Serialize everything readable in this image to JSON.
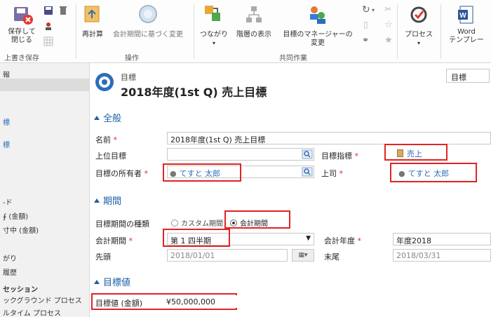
{
  "ribbon": {
    "save_close": "保存して\n閉じる",
    "save_group": "上書き保存",
    "recalc": "再計算",
    "fiscal_change": "会計期間に基づく変更",
    "ops_group": "操作",
    "connection": "つながり",
    "hierarchy": "階層の表示",
    "manager_change": "目標のマネージャーの\n変更",
    "collab_group": "共同作業",
    "process": "プロセス",
    "word_template": "Word\nテンプレー"
  },
  "leftnav": {
    "items": [
      {
        "label": "報",
        "blue": false
      },
      {
        "label": "標",
        "blue": true
      },
      {
        "label": "標",
        "blue": true
      },
      {
        "label": "-ド",
        "blue": false
      },
      {
        "label": "∮ (金額)",
        "blue": false
      },
      {
        "label": "寸中 (金額)",
        "blue": false
      },
      {
        "label": "がり",
        "blue": false
      },
      {
        "label": "履歴",
        "blue": false
      },
      {
        "label": "セッション",
        "blue": false
      },
      {
        "label": "ックグラウンド プロセス",
        "blue": false
      },
      {
        "label": "ルタイム プロセス",
        "blue": false
      }
    ]
  },
  "header": {
    "entity": "目標",
    "title": "2018年度(1st Q) 売上目標",
    "form_selector": "目標"
  },
  "sections": {
    "general": "全般",
    "period": "期間",
    "target": "目標値"
  },
  "fields": {
    "name_label": "名前",
    "name_value": "2018年度(1st Q) 売上目標",
    "parent_label": "上位目標",
    "parent_value": "",
    "metric_label": "目標指標",
    "metric_value": "売上",
    "owner_label": "目標の所有者",
    "owner_value": "てすと 太郎",
    "manager_label": "上司",
    "manager_value": "てすと 太郎",
    "period_type_label": "目標期間の種類",
    "custom_period": "カスタム期間",
    "fiscal_period_opt": "会計期間",
    "fiscal_period_label": "会計期間",
    "fiscal_period_value": "第 1 四半期",
    "fiscal_year_label": "会計年度",
    "fiscal_year_value": "年度2018",
    "start_label": "先頭",
    "start_value": "2018/01/01",
    "end_label": "末尾",
    "end_value": "2018/03/31",
    "target_amount_label": "目標値 (金額)",
    "target_amount_value": "¥50,000,000"
  },
  "required_mark": "*"
}
